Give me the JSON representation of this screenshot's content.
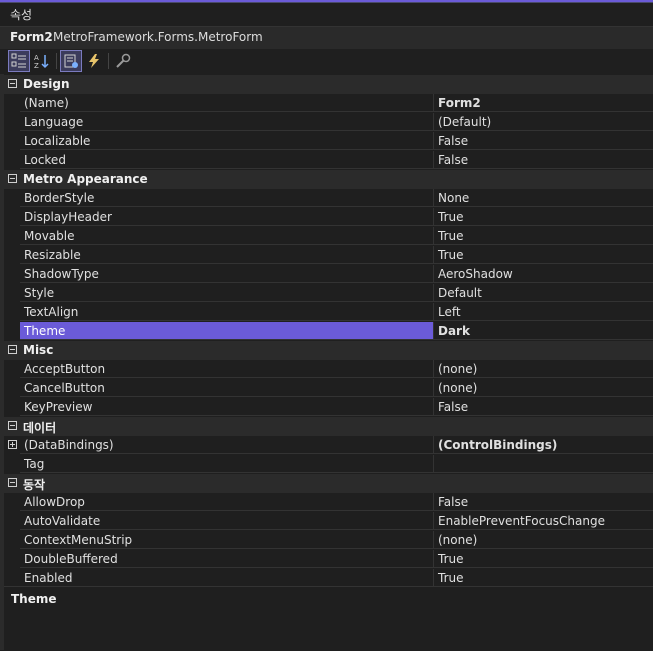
{
  "window": {
    "title": "속성"
  },
  "object_selector": {
    "name": "Form2",
    "type": "MetroFramework.Forms.MetroForm"
  },
  "toolbar": {
    "buttons": [
      {
        "icon": "categorized-icon",
        "active": true
      },
      {
        "icon": "alphabetical-icon",
        "active": false
      },
      {
        "icon": "properties-icon",
        "active": true
      },
      {
        "icon": "events-icon",
        "active": false
      },
      {
        "icon": "property-pages-icon",
        "active": false
      }
    ]
  },
  "colors": {
    "accent": "#6b5bd8",
    "background": "#1f1f1f",
    "category_bg": "#2b2b2b"
  },
  "categories": [
    {
      "label": "Design",
      "properties": [
        {
          "name": "(Name)",
          "value": "Form2",
          "bold": true
        },
        {
          "name": "Language",
          "value": "(Default)"
        },
        {
          "name": "Localizable",
          "value": "False"
        },
        {
          "name": "Locked",
          "value": "False"
        }
      ]
    },
    {
      "label": "Metro Appearance",
      "properties": [
        {
          "name": "BorderStyle",
          "value": "None"
        },
        {
          "name": "DisplayHeader",
          "value": "True"
        },
        {
          "name": "Movable",
          "value": "True"
        },
        {
          "name": "Resizable",
          "value": "True"
        },
        {
          "name": "ShadowType",
          "value": "AeroShadow"
        },
        {
          "name": "Style",
          "value": "Default"
        },
        {
          "name": "TextAlign",
          "value": "Left"
        },
        {
          "name": "Theme",
          "value": "Dark",
          "bold": true,
          "selected": true
        }
      ]
    },
    {
      "label": "Misc",
      "properties": [
        {
          "name": "AcceptButton",
          "value": "(none)"
        },
        {
          "name": "CancelButton",
          "value": "(none)"
        },
        {
          "name": "KeyPreview",
          "value": "False"
        }
      ]
    },
    {
      "label": "데이터",
      "properties": [
        {
          "name": "(DataBindings)",
          "value": "(ControlBindings)",
          "bold": true,
          "expandable": true
        },
        {
          "name": "Tag",
          "value": ""
        }
      ]
    },
    {
      "label": "동작",
      "properties": [
        {
          "name": "AllowDrop",
          "value": "False"
        },
        {
          "name": "AutoValidate",
          "value": "EnablePreventFocusChange"
        },
        {
          "name": "ContextMenuStrip",
          "value": "(none)"
        },
        {
          "name": "DoubleBuffered",
          "value": "True"
        },
        {
          "name": "Enabled",
          "value": "True"
        }
      ]
    }
  ],
  "description": {
    "title": "Theme"
  }
}
